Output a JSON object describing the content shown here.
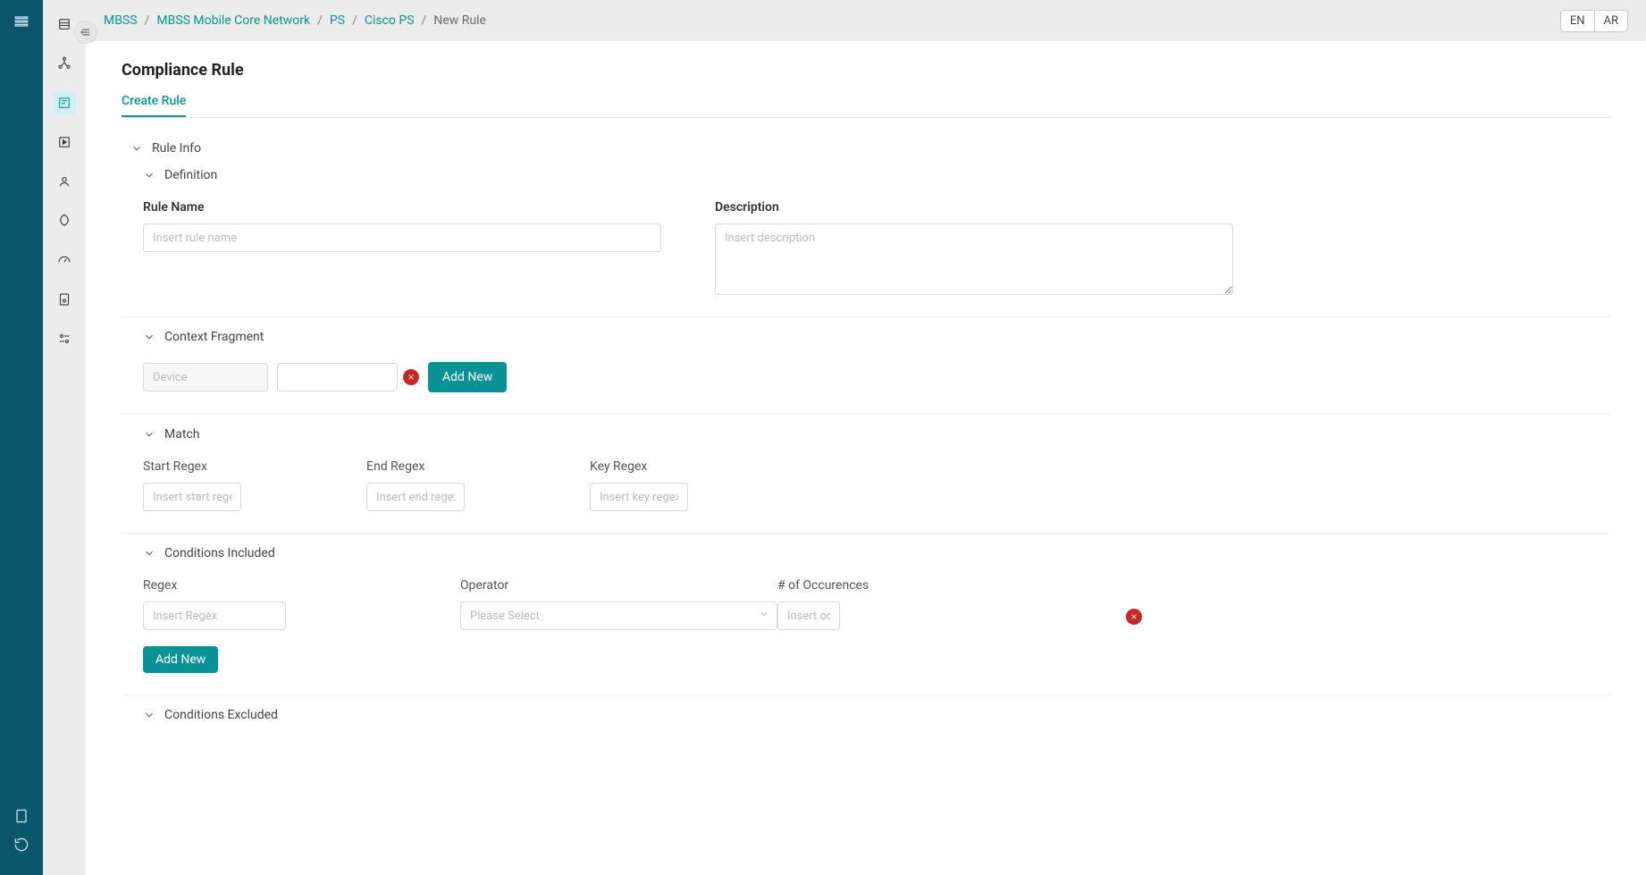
{
  "lang": {
    "en": "EN",
    "ar": "AR"
  },
  "breadcrumb": {
    "items": [
      "MBSS",
      "MBSS Mobile Core Network",
      "PS",
      "Cisco PS"
    ],
    "current": "New Rule"
  },
  "page_title": "Compliance Rule",
  "tab_label": "Create Rule",
  "sections": {
    "rule_info": "Rule Info",
    "definition": "Definition",
    "context_fragment": "Context Fragment",
    "match": "Match",
    "conditions_included": "Conditions Included",
    "conditions_excluded": "Conditions Excluded"
  },
  "labels": {
    "rule_name": "Rule Name",
    "description": "Description",
    "start_regex": "Start Regex",
    "end_regex": "End Regex",
    "key_regex": "Key Regex",
    "regex": "Regex",
    "operator": "Operator",
    "occurrences": "# of Occurences"
  },
  "placeholders": {
    "rule_name": "Insert rule name",
    "description": "Insert description",
    "device": "Device",
    "start_regex": "Insert start regex",
    "end_regex": "Insert end regex",
    "key_regex": "Insert key regex",
    "regex": "Insert Regex",
    "operator": "Please Select",
    "occurrences": "Insert occu"
  },
  "buttons": {
    "add_new": "Add New"
  }
}
